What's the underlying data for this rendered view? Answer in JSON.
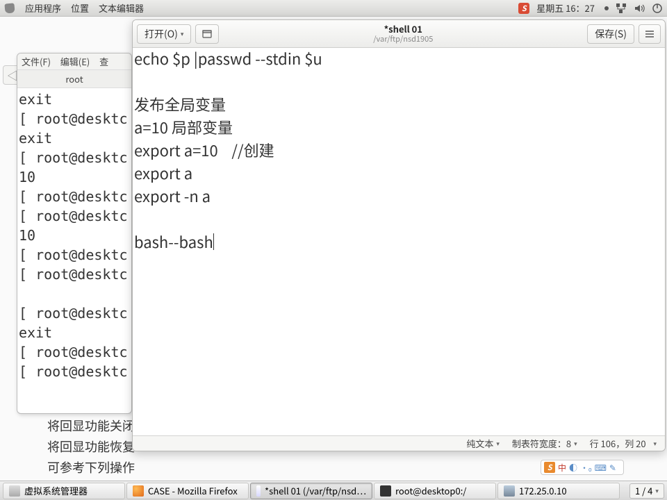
{
  "top_panel": {
    "app_menu": "应用程序",
    "places_menu": "位置",
    "active_app": "文本编辑器",
    "date": "星期五 16：27",
    "ime_badge": "S"
  },
  "back_window": {
    "menu_file": "文件(F)",
    "menu_edit": "编辑(E)",
    "menu_view": "查",
    "tab_label": "root",
    "content": "exit\n[ root@desktc\nexit\n[ root@desktc\n10\n[ root@desktc\n[ root@desktc\n10\n[ root@desktc\n[ root@desktc\n\n[ root@desktc\nexit\n[ root@desktc\n[ root@desktc"
  },
  "trailing": {
    "l1": "将回显功能关闭",
    "l2": "将回显功能恢复",
    "l3": "可参考下列操作"
  },
  "editor": {
    "open_label": "打开(O)",
    "save_label": "保存(S)",
    "title": "*shell 01",
    "subtitle": "/var/ftp/nsd1905",
    "content": "echo $p |passwd --stdin $u\n\n发布全局变量\na=10 局部变量\nexport a=10    //创建\nexport a\nexport -n a\n\nbash--bash",
    "status_mode": "纯文本",
    "status_tab": "制表符宽度：8",
    "status_pos": "行 106，列 20"
  },
  "ime_bar": {
    "badge": "S",
    "label": "中"
  },
  "taskbar": {
    "items": [
      "虚拟系统管理器",
      "CASE - Mozilla Firefox",
      "*shell 01 (/var/ftp/nsd…",
      "root@desktop0:/",
      "172.25.0.10"
    ],
    "workspace": "1 / 4"
  },
  "icons": {
    "caret": "▾",
    "back": "◁"
  }
}
